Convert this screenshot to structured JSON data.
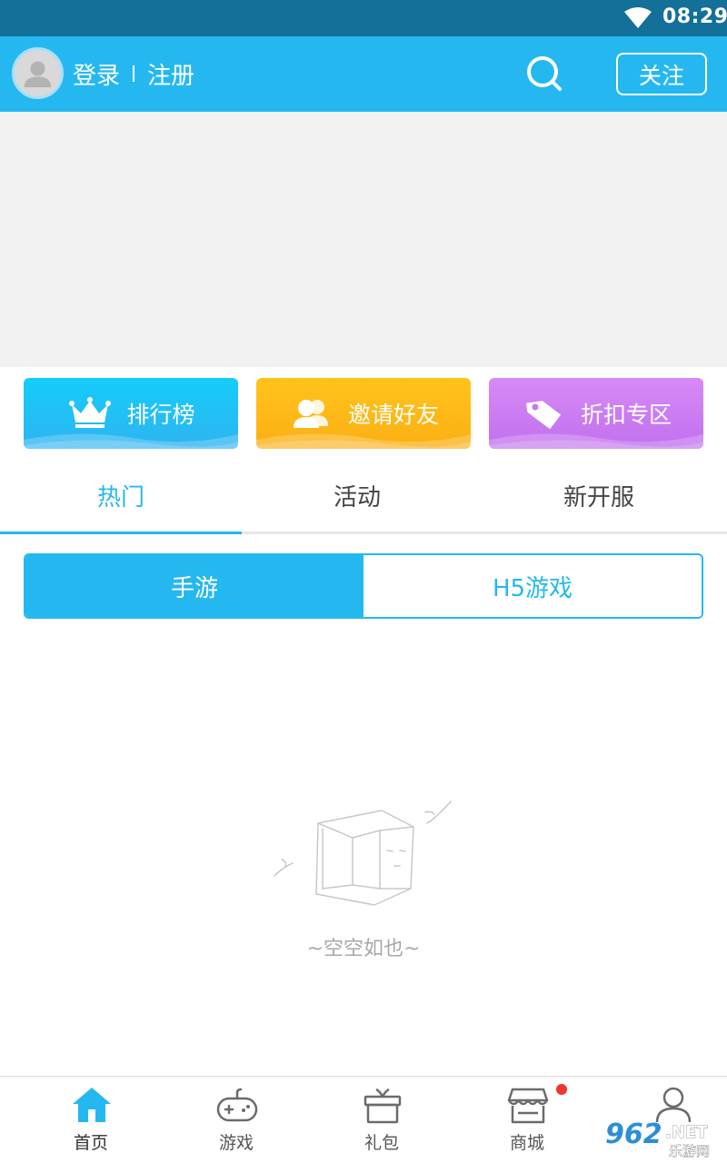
{
  "status_bar": {
    "time": "08:29",
    "wifi_icon": "wifi-icon"
  },
  "header": {
    "login": "登录",
    "register": "注册",
    "follow_label": "关注",
    "background": "#25b8f0",
    "search_icon": "search-icon",
    "avatar_icon": "avatar-icon"
  },
  "quick_actions": [
    {
      "label": "排行榜",
      "icon": "crown-icon",
      "color": "#14cdf9"
    },
    {
      "label": "邀请好友",
      "icon": "friends-icon",
      "color": "#ffc31b"
    },
    {
      "label": "折扣专区",
      "icon": "tag-icon",
      "color": "#d889f6"
    }
  ],
  "tabs": [
    {
      "label": "热门",
      "active": true
    },
    {
      "label": "活动",
      "active": false
    },
    {
      "label": "新开服",
      "active": false
    }
  ],
  "segments": [
    {
      "label": "手游",
      "active": true
    },
    {
      "label": "H5游戏",
      "active": false
    }
  ],
  "empty_state": {
    "text": "~空空如也~",
    "icon": "empty-box-icon"
  },
  "bottom_nav": [
    {
      "label": "首页",
      "icon": "home-icon",
      "active": true
    },
    {
      "label": "游戏",
      "icon": "gamepad-icon",
      "active": false
    },
    {
      "label": "礼包",
      "icon": "gift-icon",
      "active": false
    },
    {
      "label": "商城",
      "icon": "store-icon",
      "active": false,
      "badge": true
    },
    {
      "label": "",
      "icon": "user-icon",
      "active": false
    }
  ],
  "watermark": {
    "text": "962.NET",
    "subtext": "乐游网"
  },
  "colors": {
    "accent": "#25b8f0",
    "status_bar": "#137099",
    "badge": "#f2352e"
  }
}
